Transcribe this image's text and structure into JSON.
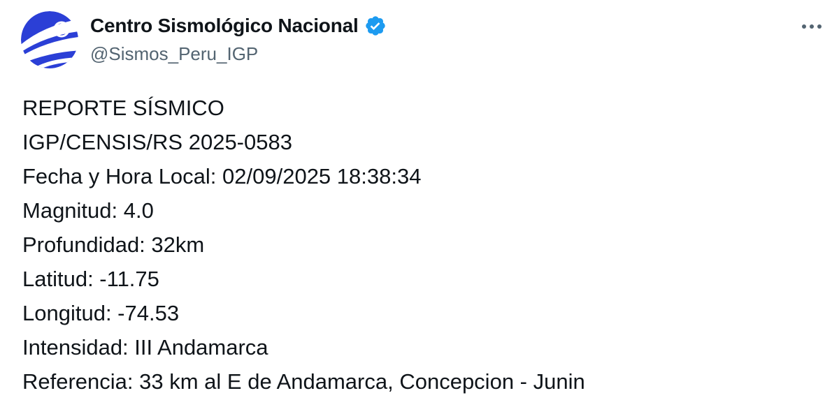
{
  "author": {
    "display_name": "Centro Sismológico Nacional",
    "handle": "@Sismos_Peru_IGP",
    "verified": true,
    "avatar_icon": "igp-logo-icon"
  },
  "colors": {
    "text_primary": "#0f1419",
    "text_secondary": "#536471",
    "verified_blue": "#1d9bf0",
    "avatar_blue": "#2b3fd6"
  },
  "actions": {
    "more_icon": "more-horizontal-icon"
  },
  "tweet": {
    "lines": [
      "REPORTE SÍSMICO",
      "IGP/CENSIS/RS 2025-0583",
      "Fecha y Hora Local: 02/09/2025 18:38:34",
      "Magnitud: 4.0",
      "Profundidad: 32km",
      "Latitud: -11.75",
      "Longitud: -74.53",
      "Intensidad: III Andamarca",
      "Referencia: 33 km al E de Andamarca, Concepcion - Junin"
    ]
  }
}
